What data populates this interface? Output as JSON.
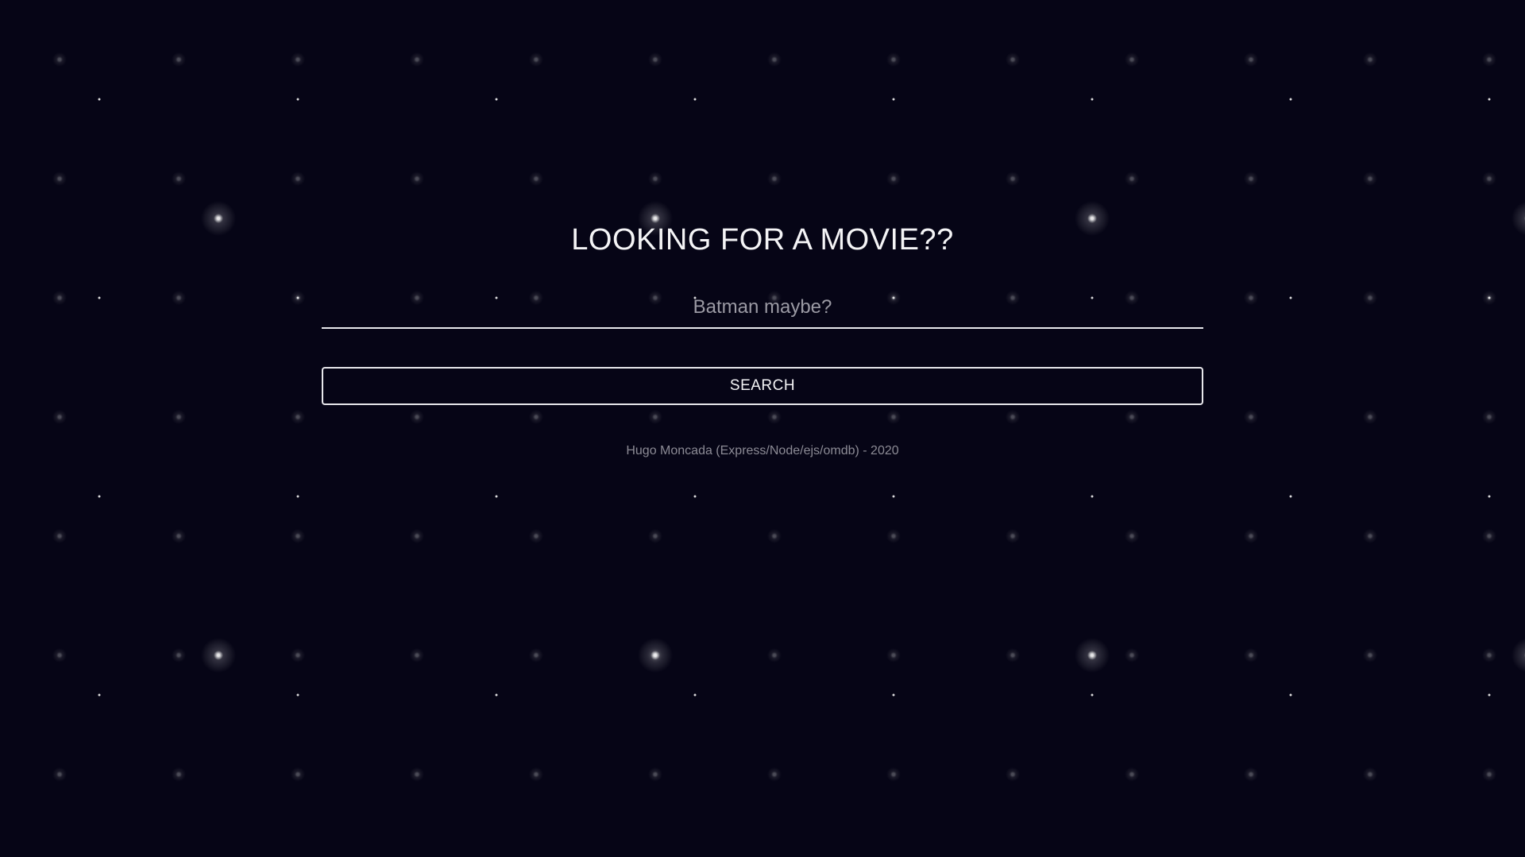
{
  "main": {
    "title": "LOOKING FOR A MOVIE??",
    "search": {
      "placeholder": "Batman maybe?",
      "value": ""
    },
    "search_button_label": "SEARCH",
    "footer_credit": "Hugo Moncada (Express/Node/ejs/omdb) - 2020"
  },
  "colors": {
    "background": "#060516",
    "text": "#f4f4f6",
    "muted_text": "#8c8b95",
    "border": "#e8e8ec"
  }
}
